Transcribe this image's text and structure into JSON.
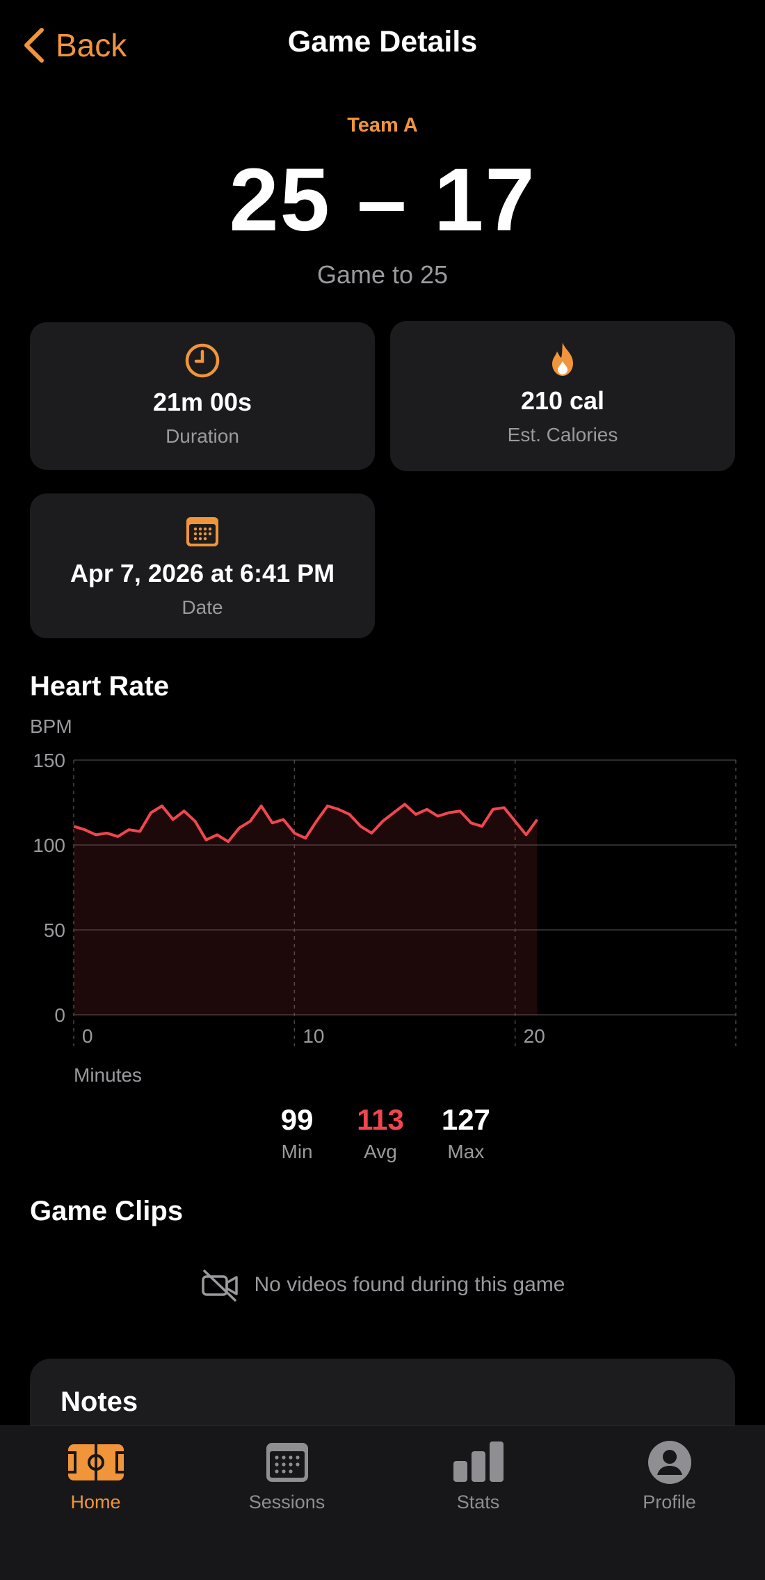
{
  "nav": {
    "back_label": "Back",
    "title": "Game Details"
  },
  "game": {
    "team": "Team A",
    "score": "25 – 17",
    "subtitle": "Game to 25"
  },
  "stats": {
    "duration": {
      "value": "21m 00s",
      "label": "Duration",
      "icon": "clock-icon"
    },
    "calories": {
      "value": "210 cal",
      "label": "Est. Calories",
      "icon": "flame-icon"
    },
    "date": {
      "value": "Apr 7, 2026 at 6:41 PM",
      "label": "Date",
      "icon": "calendar-icon"
    }
  },
  "heart_rate": {
    "title": "Heart Rate",
    "min": {
      "value": "99",
      "label": "Min"
    },
    "avg": {
      "value": "113",
      "label": "Avg"
    },
    "max": {
      "value": "127",
      "label": "Max"
    }
  },
  "chart_data": {
    "type": "area",
    "title": "Heart Rate",
    "ylabel": "BPM",
    "xlabel": "Minutes",
    "ylim": [
      0,
      150
    ],
    "xlim": [
      0,
      30
    ],
    "y_ticks": [
      "0",
      "50",
      "100",
      "150"
    ],
    "x_ticks": [
      "0",
      "10",
      "20"
    ],
    "grid": true,
    "series": [
      {
        "color": "#f2464e",
        "x": [
          0,
          0.5,
          1,
          1.5,
          2,
          2.5,
          3,
          3.5,
          4,
          4.5,
          5,
          5.5,
          6,
          6.5,
          7,
          7.5,
          8,
          8.5,
          9,
          9.5,
          10,
          10.5,
          11,
          11.5,
          12,
          12.5,
          13,
          13.5,
          14,
          14.5,
          15,
          15.5,
          16,
          16.5,
          17,
          17.5,
          18,
          18.5,
          19,
          19.5,
          20,
          20.5,
          21
        ],
        "y": [
          111,
          109,
          106,
          107,
          105,
          109,
          108,
          119,
          123,
          115,
          120,
          114,
          103,
          106,
          102,
          110,
          114,
          123,
          113,
          115,
          107,
          104,
          114,
          123,
          121,
          118,
          111,
          107,
          114,
          119,
          124,
          118,
          121,
          117,
          119,
          120,
          113,
          111,
          121,
          122,
          114,
          106,
          115
        ]
      }
    ]
  },
  "clips": {
    "title": "Game Clips",
    "empty_text": "No videos found during this game",
    "icon": "video-off-icon"
  },
  "notes": {
    "title": "Notes"
  },
  "tabs": [
    {
      "label": "Home",
      "icon": "court-icon",
      "active": true
    },
    {
      "label": "Sessions",
      "icon": "calendar-grid-icon",
      "active": false
    },
    {
      "label": "Stats",
      "icon": "bar-chart-icon",
      "active": false
    },
    {
      "label": "Profile",
      "icon": "person-icon",
      "active": false
    }
  ],
  "colors": {
    "accent": "#f0953a",
    "heart": "#f2464e",
    "card": "#1c1c1e",
    "muted": "#9a9a9e"
  }
}
